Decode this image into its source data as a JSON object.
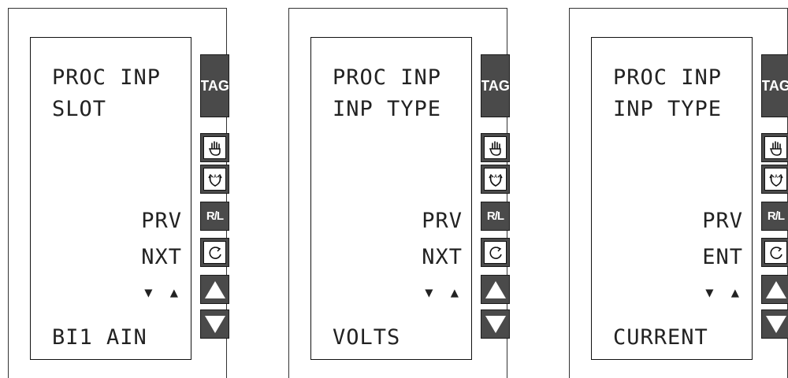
{
  "panels": [
    {
      "line1": "PROC INP",
      "line2": "SLOT",
      "right1": "PRV",
      "right2": "NXT",
      "arrows": "▼ ▲",
      "bottom": "BI1 AIN"
    },
    {
      "line1": "PROC INP",
      "line2": "INP TYPE",
      "right1": "PRV",
      "right2": "NXT",
      "arrows": "▼ ▲",
      "bottom": "VOLTS"
    },
    {
      "line1": "PROC INP",
      "line2": "INP TYPE",
      "right1": "PRV",
      "right2": "ENT",
      "arrows": "▼ ▲",
      "bottom": "CURRENT"
    }
  ],
  "buttons": {
    "tag_label": "TAG",
    "rl_label": "R/L",
    "icons": [
      "hand-icon",
      "auto-icon",
      "cycle-icon",
      "up-arrow-icon",
      "down-arrow-icon"
    ]
  },
  "colors": {
    "button_fill": "#4a4a4a",
    "button_text": "#ffffff",
    "lcd_text": "#222222"
  }
}
